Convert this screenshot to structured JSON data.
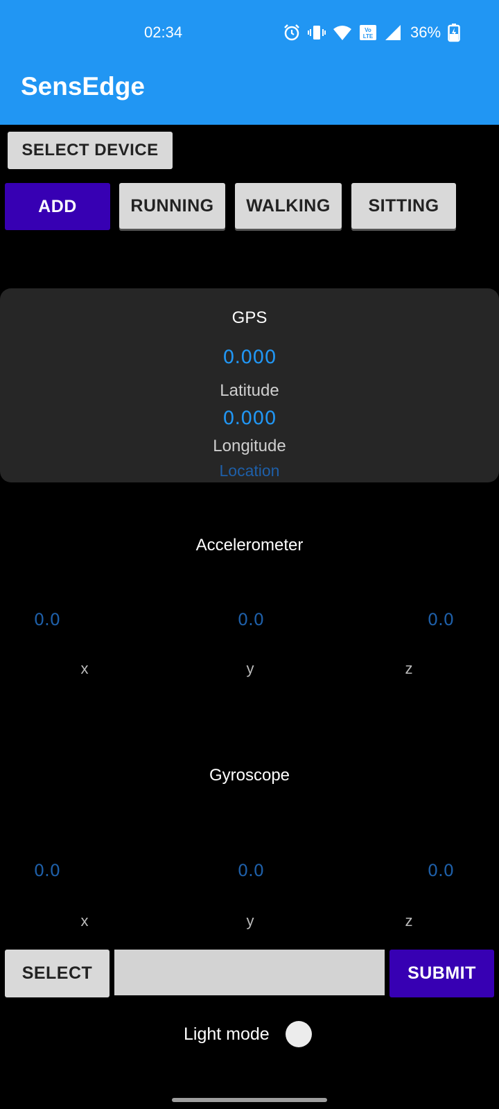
{
  "status_bar": {
    "time": "02:34",
    "battery_percent": "36%",
    "icons": [
      "alarm-icon",
      "vibrate-icon",
      "wifi-icon",
      "volte-icon",
      "signal-icon",
      "battery-charging-icon"
    ]
  },
  "app_bar": {
    "title": "SensEdge",
    "color": "#2196F3"
  },
  "toolbar": {
    "select_device_label": "SELECT DEVICE",
    "add_label": "ADD",
    "running_label": "RUNNING",
    "walking_label": "WALKING",
    "sitting_label": "SITTING"
  },
  "gps": {
    "title": "GPS",
    "latitude_value": "0.000",
    "latitude_label": "Latitude",
    "longitude_value": "0.000",
    "longitude_label": "Longitude",
    "location_label": "Location"
  },
  "accelerometer": {
    "title": "Accelerometer",
    "x_value": "0.0",
    "y_value": "0.0",
    "z_value": "0.0",
    "x_label": "x",
    "y_label": "y",
    "z_label": "z"
  },
  "gyroscope": {
    "title": "Gyroscope",
    "x_value": "0.0",
    "y_value": "0.0",
    "z_value": "0.0",
    "x_label": "x",
    "y_label": "y",
    "z_label": "z"
  },
  "bottom_bar": {
    "select_label": "SELECT",
    "input_value": "",
    "submit_label": "SUBMIT",
    "light_mode_label": "Light mode"
  },
  "colors": {
    "accent_purple": "#3700B3",
    "value_blue": "#2196F3",
    "card_bg": "#262626"
  }
}
